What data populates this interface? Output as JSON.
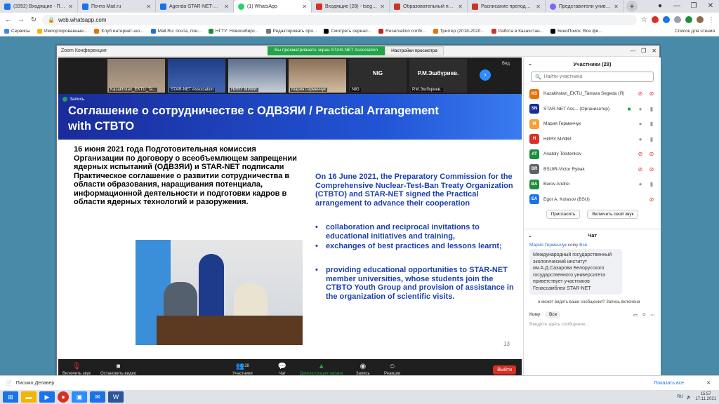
{
  "browser": {
    "tabs": [
      {
        "title": "(3352) Входящие - Почта",
        "color": "#1a73e8"
      },
      {
        "title": "Почта Mail.ru",
        "color": "#1a73e8"
      },
      {
        "title": "Agenda-STAR-NET-GA-202",
        "color": "#1a73e8"
      },
      {
        "title": "(1) WhatsApp",
        "color": "#25d366"
      },
      {
        "title": "Входящие (28) - tsegeda@",
        "color": "#d93025"
      },
      {
        "title": "Образовательный портал",
        "color": "#c53929"
      },
      {
        "title": "Расписание преподавате",
        "color": "#c53929"
      },
      {
        "title": "Представители универси",
        "color": "#7b68ee"
      }
    ],
    "url": "web.whatsapp.com",
    "bookmarks": [
      "Сервисы",
      "Импортированные...",
      "Клуб интернет-шо...",
      "Mail.Ru: почта, пои...",
      "НГТУ: Новосибирс...",
      "Редактировать про...",
      "Смотреть сериал...",
      "Reservation confir...",
      "Триггер (2018-2020...",
      "Работа в Казахстан...",
      "КиноПоиск. Все фи...",
      "Список для чтения"
    ]
  },
  "zoom": {
    "title": "Zoom Конференция",
    "banner": "Вы просматриваете экран STAR-NET Association",
    "view_options": "Настройки просмотра",
    "thumbs": [
      {
        "label": "Kazakhstan_EKTU_Ta..."
      },
      {
        "label": "STAR-NET Association"
      },
      {
        "label": "НИЯУ МИФИ"
      },
      {
        "label": "Мария Герменчук"
      },
      {
        "label": "NIG",
        "big": "NIG"
      },
      {
        "label": "Р.М.Эшбүриев.",
        "big": "Р.М.Эшбүриев."
      }
    ],
    "view_label": "Вид",
    "slide": {
      "recording": "Запись",
      "title": "Соглашение о сотрудничестве с ОДВЗЯИ / Practical Arrangement with CTBTO",
      "left_text": "16 июня 2021 года Подготовительная комиссия Организации по договору о всеобъемлющем запрещении ядерных испытаний (ОДВЗЯИ) и STAR-NET подписали Практическое соглашение о развитии сотрудничества в области образования, наращивания потенциала, информационной деятельности и подготовки кадров в области ядерных технологий и разоружения.",
      "right_head": "On 16 June 2021, the Preparatory Commission for the Comprehensive Nuclear-Test-Ban Treaty Organization (CTBTO) and STAR-NET signed the Practical arrangement to advance their cooperation",
      "bullets": [
        "collaboration and reciprocal invitations to educational initiatives and training,",
        "exchanges of best practices and lessons learnt;",
        "providing educational opportunities to STAR-NET member universities, whose students join the CTBTO Youth Group and provision of assistance in the organization of scientific visits."
      ],
      "page_number": "13"
    },
    "toolbar": {
      "unmute": "Включить звук",
      "stop_video": "Остановить видео",
      "participants": "Участники",
      "participants_count": "28",
      "chat": "Чат",
      "share": "Демонстрация экрана",
      "record": "Запись",
      "reactions": "Реакции",
      "leave": "Выйти"
    },
    "participants_panel": {
      "header": "Участники (28)",
      "search_placeholder": "Найти участника",
      "list": [
        {
          "initials": "KS",
          "name": "Kazakhstan_EKTU_Tamara Segeda (Я)",
          "color": "#e8710a",
          "mic": "muted"
        },
        {
          "initials": "SN",
          "name": "STAR-NET Ass... (Организатор)",
          "color": "#1a2b9a",
          "mic": "on"
        },
        {
          "initials": "M",
          "name": "Мария Герменчук",
          "color": "#f4a13b",
          "mic": "on"
        },
        {
          "initials": "Н",
          "name": "НИЯУ МИФИ",
          "color": "#d93025",
          "mic": "on"
        },
        {
          "initials": "AT",
          "name": "Anatoly Tolstenkov",
          "color": "#1e8e3e",
          "mic": "muted"
        },
        {
          "initials": "BR",
          "name": "BSUIR-Victor Rybak",
          "color": "#5f6368",
          "mic": "muted"
        },
        {
          "initials": "BA",
          "name": "Burov Andrei",
          "color": "#1e8e3e",
          "mic": "on"
        },
        {
          "initials": "EA",
          "name": "Egor A. Kolasov (BSU)",
          "color": "#1a73e8",
          "mic": "muted"
        }
      ],
      "invite": "Пригласить",
      "unmute_me": "Включить свой звук"
    },
    "chat": {
      "header": "Чат",
      "from": "Мария Герменчук",
      "to_label": "кому",
      "to": "Все",
      "message": "Международный государственный экологический институт им.А.Д.Сахарова Белорусского государственного университета приветствует участников Генассамблеи STAR-NET",
      "note": "о может видеть ваши сообщения? Запись включена",
      "to_prefix": "Кому:",
      "to_select": "Все",
      "input_placeholder": "Введите здесь сообщение..."
    }
  },
  "notification": {
    "text": "Письмо Делавер",
    "show": "Показать все"
  },
  "tray": {
    "lang": "RU",
    "time": "15:57",
    "date": "17.11.2021"
  }
}
